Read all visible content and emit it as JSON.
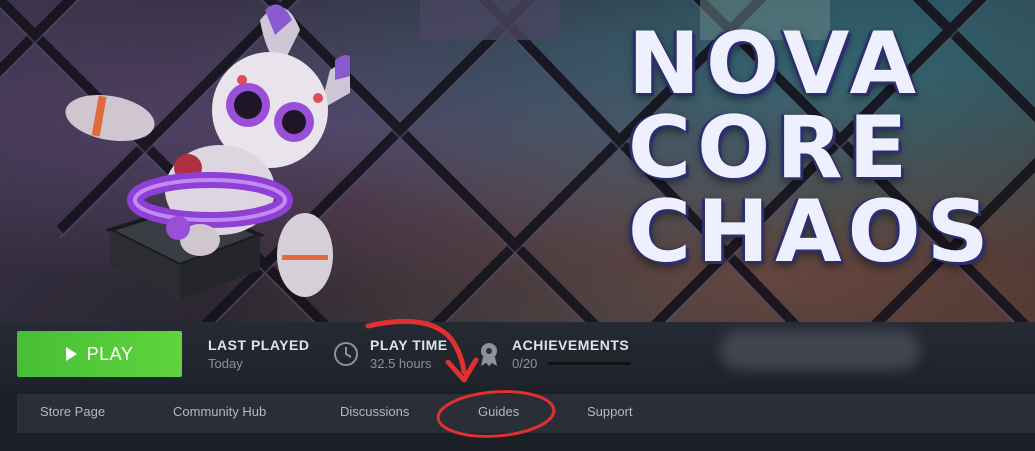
{
  "game": {
    "logo_lines": [
      "NOVA",
      "CORE",
      "CHAOS"
    ]
  },
  "actions": {
    "play_label": "PLAY",
    "last_played": {
      "title": "LAST PLAYED",
      "value": "Today"
    },
    "play_time": {
      "title": "PLAY TIME",
      "value": "32.5 hours"
    },
    "achievements": {
      "title": "ACHIEVEMENTS",
      "value": "0/20",
      "progress": 0
    }
  },
  "subnav": {
    "items": [
      "Store Page",
      "Community Hub",
      "Discussions",
      "Guides",
      "Support"
    ]
  },
  "colors": {
    "play_green": "#5fd43f",
    "annotation_red": "#e03030"
  },
  "icons": {
    "play": "play-triangle-icon",
    "clock": "clock-icon",
    "achievements": "gear-badge-icon"
  }
}
